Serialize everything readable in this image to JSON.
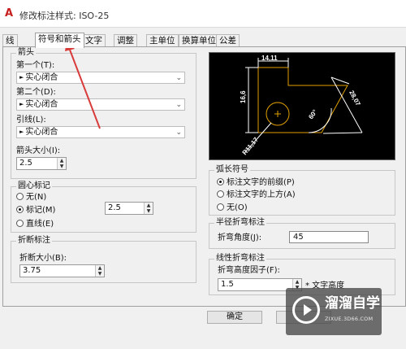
{
  "window": {
    "title": "修改标注样式: ISO-25",
    "app_icon_letter": "A"
  },
  "tabs": [
    {
      "label": "线",
      "active": false
    },
    {
      "label": "符号和箭头",
      "active": true
    },
    {
      "label": "文字",
      "active": false
    },
    {
      "label": "调整",
      "active": false
    },
    {
      "label": "主单位",
      "active": false
    },
    {
      "label": "换算单位",
      "active": false
    },
    {
      "label": "公差",
      "active": false
    }
  ],
  "arrowheads": {
    "group_title": "箭头",
    "first_label": "第一个(T):",
    "first_value": "实心闭合",
    "second_label": "第二个(D):",
    "second_value": "实心闭合",
    "leader_label": "引线(L):",
    "leader_value": "实心闭合",
    "size_label": "箭头大小(I):",
    "size_value": "2.5",
    "arrow_glyph": "►"
  },
  "center_marks": {
    "group_title": "圆心标记",
    "options": [
      {
        "label": "无(N)",
        "selected": false
      },
      {
        "label": "标记(M)",
        "selected": true
      },
      {
        "label": "直线(E)",
        "selected": false
      }
    ],
    "size_value": "2.5"
  },
  "dim_break": {
    "group_title": "折断标注",
    "size_label": "折断大小(B):",
    "size_value": "3.75"
  },
  "preview": {
    "dim_top": "14,11",
    "dim_left": "16,6",
    "dim_diag": "28,07",
    "dim_angle": "60°",
    "dim_radius": "R11,17"
  },
  "arc_length_symbol": {
    "group_title": "弧长符号",
    "options": [
      {
        "label": "标注文字的前缀(P)",
        "selected": true
      },
      {
        "label": "标注文字的上方(A)",
        "selected": false
      },
      {
        "label": "无(O)",
        "selected": false
      }
    ]
  },
  "radius_jog": {
    "group_title": "半径折弯标注",
    "angle_label": "折弯角度(J):",
    "angle_value": "45"
  },
  "linear_jog": {
    "group_title": "线性折弯标注",
    "factor_label": "折弯高度因子(F):",
    "factor_value": "1.5",
    "factor_suffix": "* 文字高度"
  },
  "buttons": {
    "ok_label": "确定"
  },
  "watermark": {
    "title": "溜溜自学",
    "url": "ZIXUE.3D66.COM"
  },
  "colors": {
    "annotation_arrow": "#d93a3a",
    "preview_bg": "#000000",
    "preview_dim_lines": "#ffffff",
    "preview_geometry": "#e0a000",
    "watermark_bg": "#464646"
  }
}
